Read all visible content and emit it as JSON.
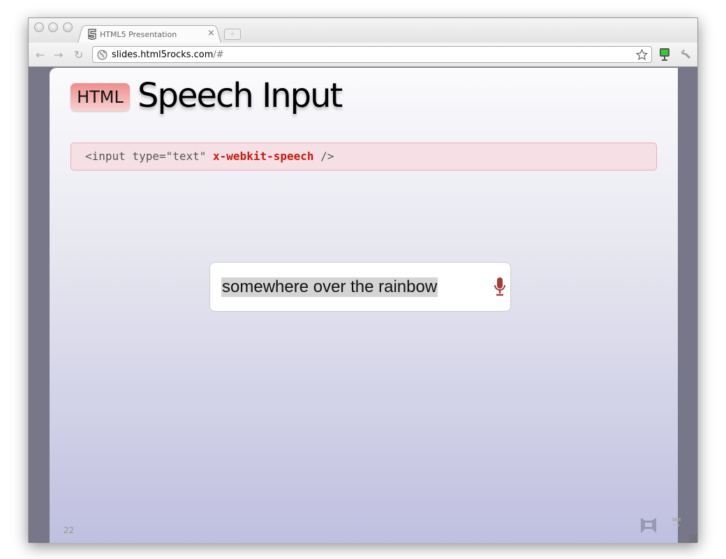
{
  "browser": {
    "tab_title": "HTML5 Presentation",
    "tab_close": "×",
    "new_tab": "+",
    "url_host": "slides.html5rocks.com",
    "url_path": "/#",
    "nav": {
      "back": "←",
      "forward": "→",
      "reload": "↻"
    }
  },
  "slide": {
    "badge": "HTML",
    "title": "Speech Input",
    "code_prefix": "<input type=\"text\" ",
    "code_keyword": "x-webkit-speech",
    "code_suffix": " />",
    "speech_value": "somewhere over the rainbow",
    "page_number": "22"
  },
  "colors": {
    "accent": "#c81a0c",
    "mic": "#a33a3a",
    "slide_bottom": "#bfbfe0",
    "frame": "#787789"
  }
}
